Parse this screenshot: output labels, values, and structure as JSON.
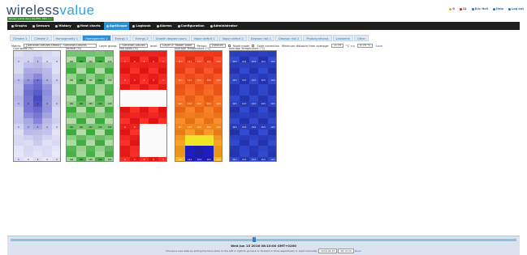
{
  "brand": {
    "word1": "wireless",
    "word2": "value"
  },
  "user_status": "Rinder (uknk dev) [S] PFD: SEA   •••",
  "top_links": [
    {
      "label": "0",
      "color": "#f0a020"
    },
    {
      "label": "11",
      "color": "#d02020"
    },
    {
      "label": "Eric Hell",
      "color": "#2a6db0"
    },
    {
      "label": "Help",
      "color": "#2a6db0"
    },
    {
      "label": "Log out",
      "color": "#2a6db0"
    }
  ],
  "nav": [
    {
      "label": "Graphs",
      "icon": "chart-icon"
    },
    {
      "label": "Sensors",
      "icon": "sensor-icon"
    },
    {
      "label": "History",
      "icon": "history-icon"
    },
    {
      "label": "Heat charts",
      "icon": "flame-icon"
    },
    {
      "label": "AgriScope",
      "icon": "plant-icon",
      "active": true
    },
    {
      "label": "Logbook",
      "icon": "book-icon"
    },
    {
      "label": "Alarms",
      "icon": "bell-icon"
    },
    {
      "label": "Configuration",
      "icon": "wrench-icon"
    },
    {
      "label": "Administrator",
      "icon": "gear-icon"
    }
  ],
  "tabs": [
    {
      "label": "Climate 1"
    },
    {
      "label": "Climate 2"
    },
    {
      "label": "Homogeneity 1"
    },
    {
      "label": "Homogeneity 2",
      "active": true
    },
    {
      "label": "Energy 1"
    },
    {
      "label": "Energy 2"
    },
    {
      "label": "Growth degree hours"
    },
    {
      "label": "Vapor deficit 1"
    },
    {
      "label": "Vapor deficit 2"
    },
    {
      "label": "Dewson risk 1"
    },
    {
      "label": "Dewson risk 2"
    },
    {
      "label": "Photosynthesis"
    },
    {
      "label": "Leistleme"
    },
    {
      "label": "Other"
    }
  ],
  "controls": {
    "matrix_label": "Matrix:",
    "matrix_value": "[GeneralCultures Demo] - GeneralCultures",
    "layer_group_label": "Layer group:",
    "layer_group_value": "GeneralCultures",
    "level_label": "level:",
    "level_value": "Layer 2: flower plant",
    "period_label": "Period:",
    "period_value": "24hours",
    "night_mode": "Night mode",
    "solar_correction": "Solar correction",
    "min_distance_label": "Minimum distance from average:",
    "min_value": "-0.75",
    "range_sep": "°C <>",
    "max_value": "0.75 °C",
    "save": "Save"
  },
  "heatmaps": [
    {
      "title": "Cold spots (%)",
      "scheme": "cold",
      "value": "0"
    },
    {
      "title": "Normal (%)",
      "scheme": "normal",
      "value": "100"
    },
    {
      "title": "Hot spots (%)",
      "scheme": "hot",
      "value": "0"
    },
    {
      "title": "Average Temperature (°C)",
      "scheme": "avg",
      "value": "19.5"
    },
    {
      "title": "Average Temperature (°C)",
      "scheme": "blue",
      "value": "19.5"
    }
  ],
  "footer": {
    "datetime": "Wed Jun 15 2016 08:10:00 GMT+0200",
    "help": "Choose a new date by sliding the time slider to the left or right to go back or forward in time respectively or input manually:",
    "date_input": "2016-06-15",
    "time_input": "08:10:00",
    "show": "show"
  }
}
